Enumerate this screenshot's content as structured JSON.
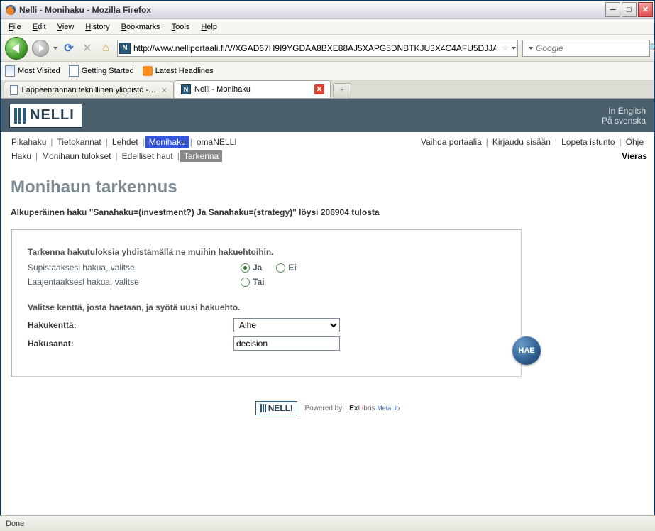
{
  "window": {
    "title": "Nelli - Monihaku - Mozilla Firefox"
  },
  "menubar": {
    "file": "File",
    "edit": "Edit",
    "view": "View",
    "history": "History",
    "bookmarks": "Bookmarks",
    "tools": "Tools",
    "help": "Help"
  },
  "toolbar": {
    "url": "http://www.nelliportaali.fi/V/XGAD67H9I9YGDAA8BXE88AJ5XAPG5DNBTKJU3X4C4AFU5DJJAN-",
    "search_placeholder": "Google"
  },
  "bookmarks_bar": {
    "most_visited": "Most Visited",
    "getting_started": "Getting Started",
    "latest_headlines": "Latest Headlines"
  },
  "tabs": {
    "tab1": "Lappeenrannan teknillinen yliopisto - Te...",
    "tab2": "Nelli - Monihaku"
  },
  "header": {
    "logo_text": "NELLI",
    "lang_en": "In English",
    "lang_sv": "På svenska"
  },
  "primary_nav": {
    "items": [
      "Pikahaku",
      "Tietokannat",
      "Lehdet",
      "Monihaku",
      "omaNELLI"
    ],
    "right": [
      "Vaihda portaalia",
      "Kirjaudu sisään",
      "Lopeta istunto",
      "Ohje"
    ]
  },
  "sub_nav": {
    "items": [
      "Haku",
      "Monihaun tulokset",
      "Edelliset haut",
      "Tarkenna"
    ],
    "right": "Vieras"
  },
  "page_title": "Monihaun tarkennus",
  "orig_query": "Alkuperäinen haku \"Sanahaku=(investment?) Ja Sanahaku=(strategy)\" löysi 206904 tulosta",
  "form": {
    "hint1": "Tarkenna hakutuloksia yhdistämällä ne muihin hakuehtoihin.",
    "narrow_label": "Supistaaksesi hakua, valitse",
    "opt_ja": "Ja",
    "opt_ei": "Ei",
    "expand_label": "Laajentaaksesi hakua, valitse",
    "opt_tai": "Tai",
    "hint2": "Valitse kenttä, josta haetaan, ja syötä uusi hakuehto.",
    "field_label": "Hakukenttä:",
    "field_value": "Aihe",
    "words_label": "Hakusanat:",
    "words_value": "decision",
    "submit": "HAE"
  },
  "footer": {
    "powered_by": "Powered by",
    "exlibris": "ExLibris",
    "metalib": "MetaLib"
  },
  "statusbar": {
    "text": "Done"
  }
}
